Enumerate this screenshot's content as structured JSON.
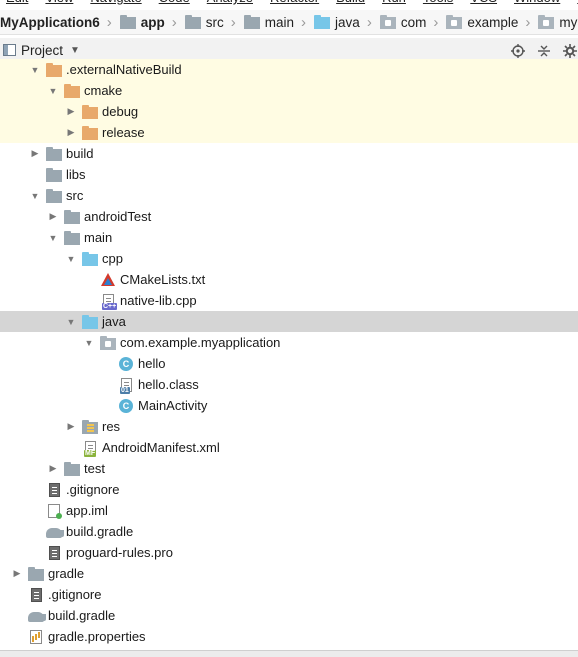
{
  "menu": [
    "Edit",
    "View",
    "Navigate",
    "Code",
    "Analyze",
    "Refactor",
    "Build",
    "Run",
    "Tools",
    "VCS",
    "Window",
    "Help"
  ],
  "breadcrumb": [
    {
      "label": "MyApplication6",
      "icon": "none",
      "bold": true
    },
    {
      "label": "app",
      "icon": "module-folder-icon",
      "bold": true
    },
    {
      "label": "src",
      "icon": "folder-icon",
      "bold": false
    },
    {
      "label": "main",
      "icon": "folder-icon",
      "bold": false
    },
    {
      "label": "java",
      "icon": "source-folder-icon",
      "bold": false
    },
    {
      "label": "com",
      "icon": "package-icon",
      "bold": false
    },
    {
      "label": "example",
      "icon": "package-icon",
      "bold": false
    },
    {
      "label": "myapplication",
      "icon": "package-icon",
      "bold": false
    }
  ],
  "toolbar": {
    "project_label": "Project",
    "icons": [
      "locate-target-icon",
      "collapse-all-icon",
      "settings-gear-icon"
    ]
  },
  "colors": {
    "excluded_bg": "#fffce3",
    "selected_bg": "#d5d5d5",
    "orange_folder": "#e8a96b",
    "blue_folder": "#77c6e8",
    "grey_folder": "#9aa7b0",
    "class_icon": "#5ab3d7"
  },
  "tree": [
    {
      "label": ".externalNativeBuild",
      "indent": 2,
      "arrow": "down",
      "icon": "orange-folder-icon",
      "state": "excluded"
    },
    {
      "label": "cmake",
      "indent": 3,
      "arrow": "down",
      "icon": "orange-folder-icon",
      "state": "excluded"
    },
    {
      "label": "debug",
      "indent": 4,
      "arrow": "right",
      "icon": "orange-folder-icon",
      "state": "excluded"
    },
    {
      "label": "release",
      "indent": 4,
      "arrow": "right",
      "icon": "orange-folder-icon",
      "state": "excluded"
    },
    {
      "label": "build",
      "indent": 2,
      "arrow": "right",
      "icon": "grey-folder-icon",
      "state": ""
    },
    {
      "label": "libs",
      "indent": 2,
      "arrow": "none",
      "icon": "grey-folder-icon",
      "state": ""
    },
    {
      "label": "src",
      "indent": 2,
      "arrow": "down",
      "icon": "grey-folder-icon",
      "state": ""
    },
    {
      "label": "androidTest",
      "indent": 3,
      "arrow": "right",
      "icon": "grey-folder-icon",
      "state": ""
    },
    {
      "label": "main",
      "indent": 3,
      "arrow": "down",
      "icon": "grey-folder-icon",
      "state": ""
    },
    {
      "label": "cpp",
      "indent": 4,
      "arrow": "down",
      "icon": "blue-folder-icon",
      "state": ""
    },
    {
      "label": "CMakeLists.txt",
      "indent": 5,
      "arrow": "none",
      "icon": "cmake-file-icon",
      "state": ""
    },
    {
      "label": "native-lib.cpp",
      "indent": 5,
      "arrow": "none",
      "icon": "cpp-file-icon",
      "state": ""
    },
    {
      "label": "java",
      "indent": 4,
      "arrow": "down",
      "icon": "blue-folder-icon",
      "state": "selected"
    },
    {
      "label": "com.example.myapplication",
      "indent": 5,
      "arrow": "down",
      "icon": "package-icon",
      "state": ""
    },
    {
      "label": "hello",
      "indent": 6,
      "arrow": "none",
      "icon": "class-icon",
      "state": ""
    },
    {
      "label": "hello.class",
      "indent": 6,
      "arrow": "none",
      "icon": "binary-class-file-icon",
      "state": ""
    },
    {
      "label": "MainActivity",
      "indent": 6,
      "arrow": "none",
      "icon": "class-icon",
      "state": ""
    },
    {
      "label": "res",
      "indent": 4,
      "arrow": "right",
      "icon": "res-folder-icon",
      "state": ""
    },
    {
      "label": "AndroidManifest.xml",
      "indent": 4,
      "arrow": "none",
      "icon": "manifest-file-icon",
      "state": ""
    },
    {
      "label": "test",
      "indent": 3,
      "arrow": "right",
      "icon": "grey-folder-icon",
      "state": ""
    },
    {
      "label": ".gitignore",
      "indent": 2,
      "arrow": "none",
      "icon": "text-file-icon",
      "state": ""
    },
    {
      "label": "app.iml",
      "indent": 2,
      "arrow": "none",
      "icon": "iml-file-icon",
      "state": ""
    },
    {
      "label": "build.gradle",
      "indent": 2,
      "arrow": "none",
      "icon": "gradle-file-icon",
      "state": ""
    },
    {
      "label": "proguard-rules.pro",
      "indent": 2,
      "arrow": "none",
      "icon": "text-file-icon",
      "state": ""
    },
    {
      "label": "gradle",
      "indent": 1,
      "arrow": "right",
      "icon": "grey-folder-icon",
      "state": ""
    },
    {
      "label": ".gitignore",
      "indent": 1,
      "arrow": "none",
      "icon": "text-file-icon",
      "state": ""
    },
    {
      "label": "build.gradle",
      "indent": 1,
      "arrow": "none",
      "icon": "gradle-file-icon",
      "state": ""
    },
    {
      "label": "gradle.properties",
      "indent": 1,
      "arrow": "none",
      "icon": "properties-file-icon",
      "state": ""
    }
  ]
}
